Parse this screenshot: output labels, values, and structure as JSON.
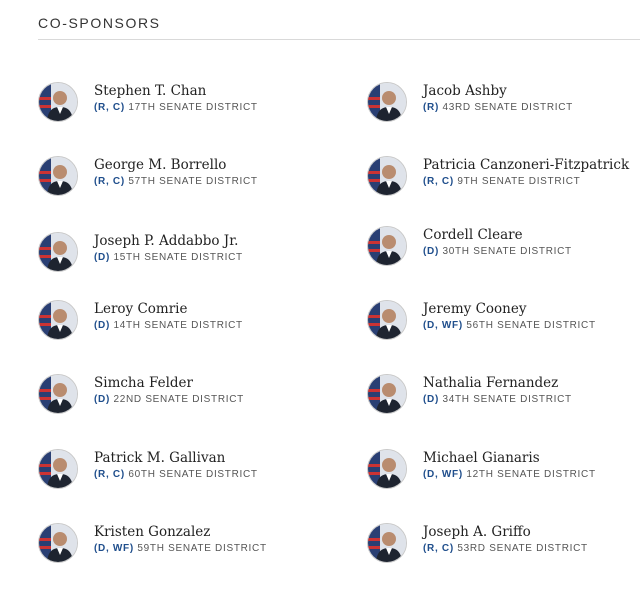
{
  "section": {
    "title": "CO-SPONSORS"
  },
  "sponsors": [
    {
      "name": "Stephen T. Chan",
      "party": "(R, C)",
      "district": "17TH SENATE DISTRICT"
    },
    {
      "name": "Jacob Ashby",
      "party": "(R)",
      "district": "43RD SENATE DISTRICT"
    },
    {
      "name": "George M. Borrello",
      "party": "(R, C)",
      "district": "57TH SENATE DISTRICT"
    },
    {
      "name": "Patricia Canzoneri-Fitzpatrick",
      "party": "(R, C)",
      "district": "9TH SENATE DISTRICT"
    },
    {
      "name": "Joseph P. Addabbo Jr.",
      "party": "(D)",
      "district": "15TH SENATE DISTRICT"
    },
    {
      "name": "Cordell Cleare",
      "party": "(D)",
      "district": "30TH SENATE DISTRICT"
    },
    {
      "name": "Leroy Comrie",
      "party": "(D)",
      "district": "14TH SENATE DISTRICT"
    },
    {
      "name": "Jeremy Cooney",
      "party": "(D, WF)",
      "district": "56TH SENATE DISTRICT"
    },
    {
      "name": "Simcha Felder",
      "party": "(D)",
      "district": "22ND SENATE DISTRICT"
    },
    {
      "name": "Nathalia Fernandez",
      "party": "(D)",
      "district": "34TH SENATE DISTRICT"
    },
    {
      "name": "Patrick M. Gallivan",
      "party": "(R, C)",
      "district": "60TH SENATE DISTRICT"
    },
    {
      "name": "Michael Gianaris",
      "party": "(D, WF)",
      "district": "12TH SENATE DISTRICT"
    },
    {
      "name": "Kristen Gonzalez",
      "party": "(D, WF)",
      "district": "59TH SENATE DISTRICT"
    },
    {
      "name": "Joseph A. Griffo",
      "party": "(R, C)",
      "district": "53RD SENATE DISTRICT"
    }
  ],
  "colors": {
    "party": "#1f4e8c",
    "name": "#222222",
    "rule": "#d9d9d9"
  },
  "icons": {
    "avatar": "senator-portrait-icon"
  }
}
